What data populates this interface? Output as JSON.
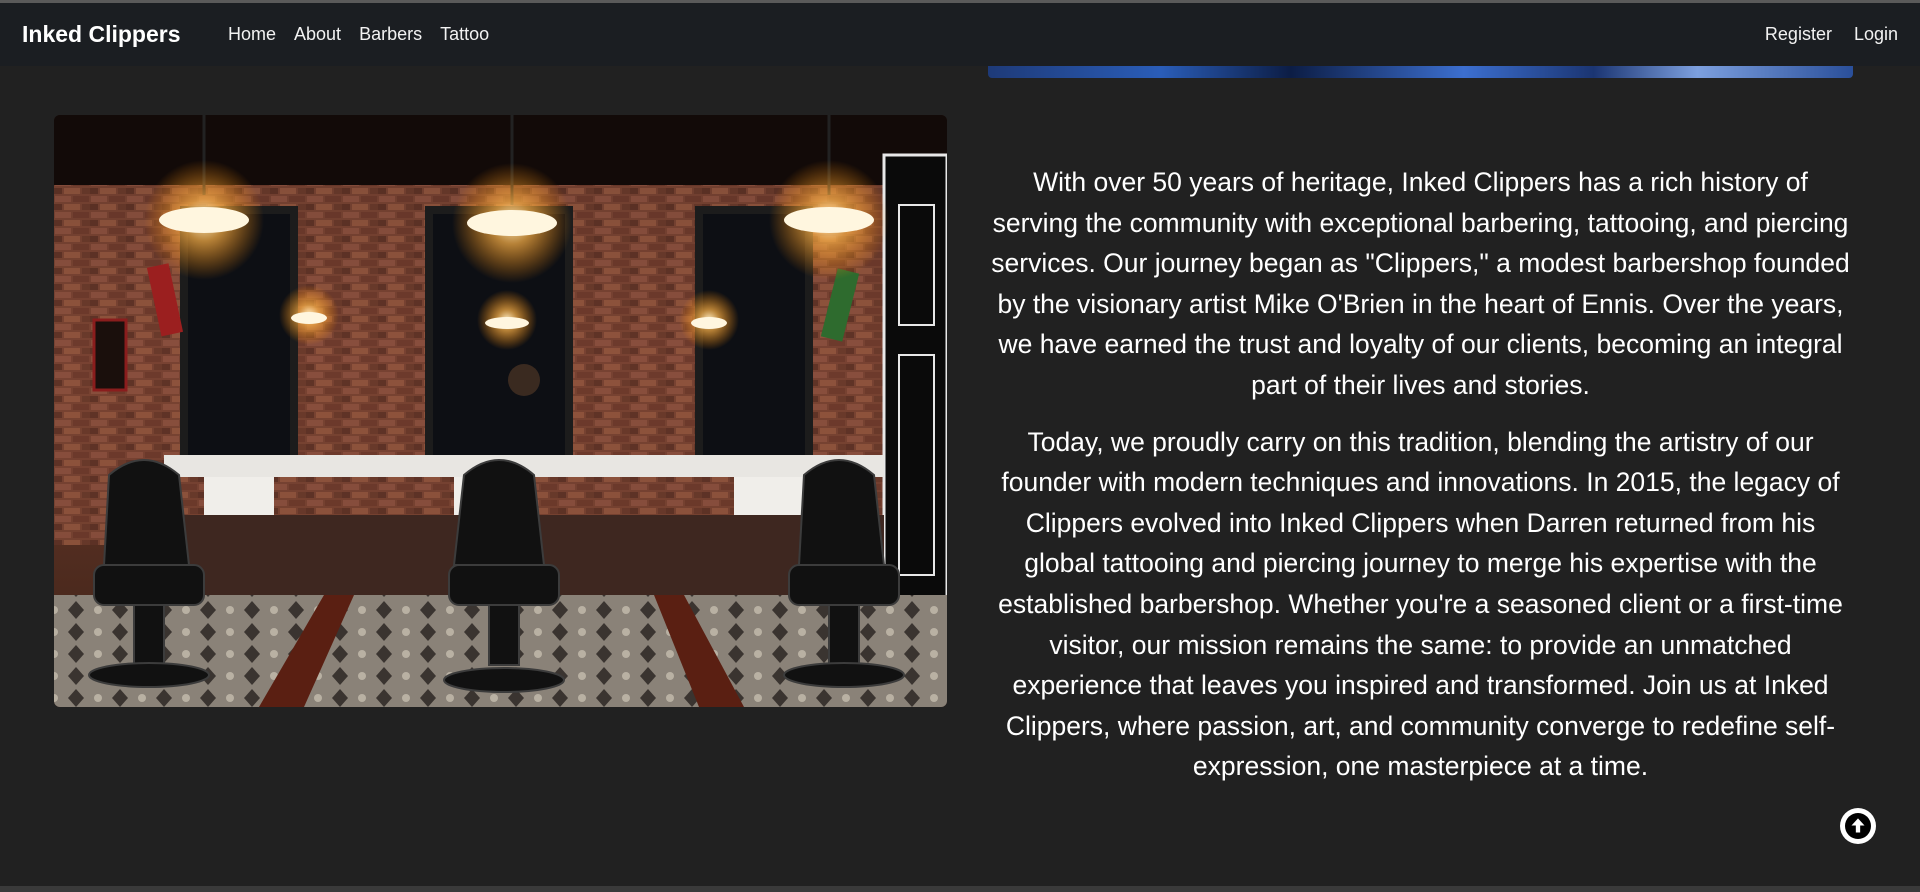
{
  "nav": {
    "brand": "Inked Clippers",
    "links": [
      "Home",
      "About",
      "Barbers",
      "Tattoo"
    ],
    "right_links": [
      "Register",
      "Login"
    ]
  },
  "image": {
    "alt": "Barbershop interior"
  },
  "about": {
    "paragraphs": [
      "With over 50 years of heritage, Inked Clippers has a rich history of serving the community with exceptional barbering, tattooing, and piercing services. Our journey began as \"Clippers,\" a modest barbershop founded by the visionary artist Mike O'Brien in the heart of Ennis. Over the years, we have earned the trust and loyalty of our clients, becoming an integral part of their lives and stories.",
      "Today, we proudly carry on this tradition, blending the artistry of our founder with modern techniques and innovations. In 2015, the legacy of Clippers evolved into Inked Clippers when Darren returned from his global tattooing and piercing journey to merge his expertise with the established barbershop. Whether you're a seasoned client or a first-time visitor, our mission remains the same: to provide an unmatched experience that leaves you inspired and transformed. Join us at Inked Clippers, where passion, art, and community converge to redefine self-expression, one masterpiece at a time."
    ]
  },
  "icons": {
    "scroll_top": "arrow-up-circle-icon"
  },
  "colors": {
    "background": "#212121",
    "navbar": "#1b1e22",
    "text": "#ffffff"
  }
}
